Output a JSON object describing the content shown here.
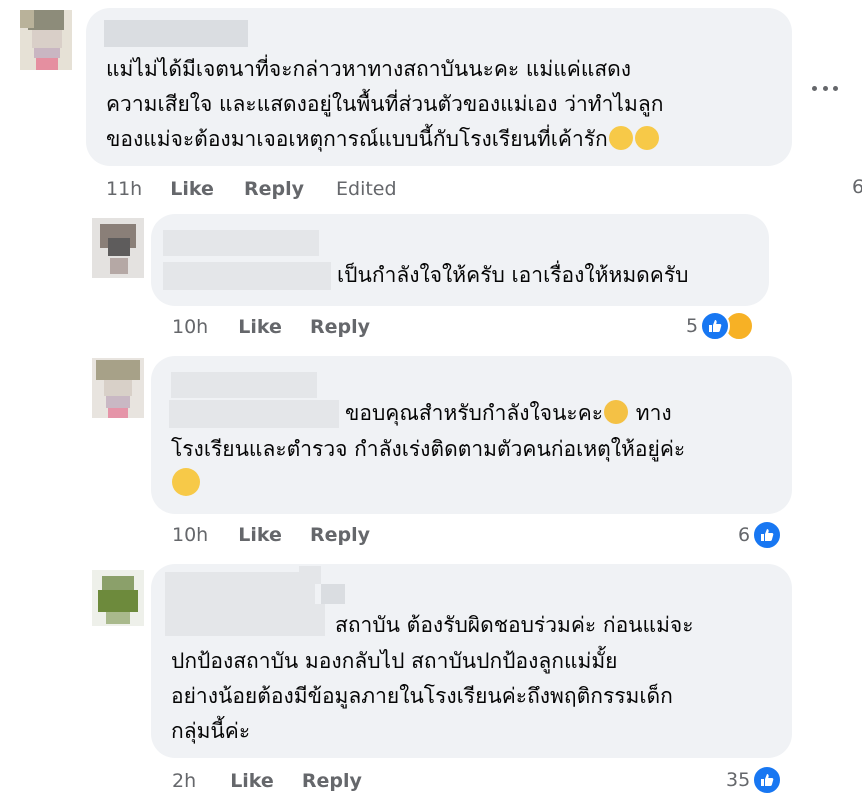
{
  "comments": [
    {
      "text_line1": "แม่ไม่ได้มีเจตนาที่จะกล่าวหาทางสถาบันนะคะ แม่แค่แสดง",
      "text_line2": "ความเสียใจ และแสดงอยู่ในพื้นที่ส่วนตัวของแม่เอง ว่าทำไมลูก",
      "text_line3": "ของแม่จะต้องมาเจอเหตุการณ์แบบนี้กับโรงเรียนที่เค้ารัก",
      "time": "11h",
      "like": "Like",
      "reply": "Reply",
      "edited": "Edited",
      "emojis": [
        "crying-face",
        "crying-face"
      ]
    },
    {
      "text_line1": "เป็นกำลังใจให้ครับ เอาเรื่องให้หมดครับ",
      "time": "10h",
      "like": "Like",
      "reply": "Reply",
      "reaction_count": "5",
      "reactions": [
        "like",
        "sad"
      ]
    },
    {
      "text_line1": "ขอบคุณสำหรับกำลังใจนะคะ",
      "text_line1_after": "ทาง",
      "text_line2": "โรงเรียนและตำรวจ กำลังเร่งติดตามตัวคนก่อเหตุให้อยู่ค่ะ",
      "time": "10h",
      "like": "Like",
      "reply": "Reply",
      "reaction_count": "6",
      "reactions": [
        "like"
      ],
      "emojis": [
        "sad-face",
        "pleading-face"
      ]
    },
    {
      "text_line1": "สถาบัน ต้องรับผิดชอบร่วมค่ะ ก่อนแม่จะ",
      "text_line2": "ปกป้องสถาบัน มองกลับไป สถาบันปกป้องลูกแม่มั้ย",
      "text_line3": "อย่างน้อยต้องมีข้อมูลภายในโรงเรียนค่ะถึงพฤติกรรมเด็ก",
      "text_line4": "กลุ่มนี้ค่ะ",
      "time": "2h",
      "like": "Like",
      "reply": "Reply",
      "reaction_count": "35",
      "reactions": [
        "like"
      ]
    }
  ],
  "partial_edge_text": "6",
  "colors": {
    "bubble": "#f0f2f5",
    "meta_text": "#65676b",
    "like_blue": "#1877f2",
    "sad_yellow": "#f7b125"
  },
  "icons": {
    "more": "more-options-icon",
    "like": "thumbs-up-icon",
    "sad": "sad-reaction-icon"
  }
}
